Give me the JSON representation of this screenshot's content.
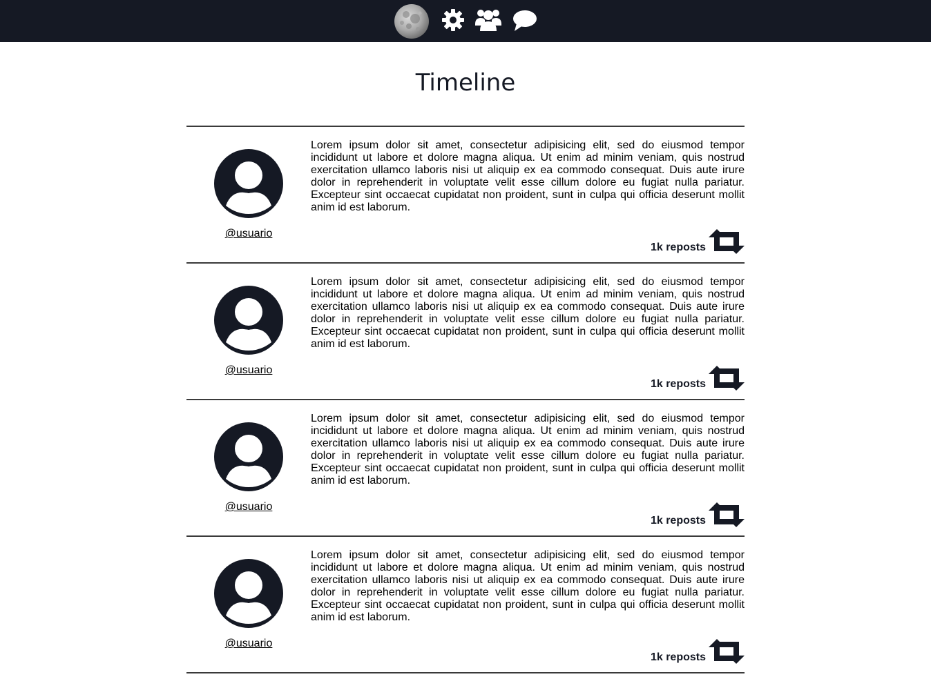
{
  "nav": {
    "icons": [
      "moon-logo-icon",
      "gear-icon",
      "users-icon",
      "chat-bubble-icon"
    ],
    "background_color": "#151924"
  },
  "page": {
    "title": "Timeline"
  },
  "posts": [
    {
      "username": "@usuario",
      "text": "Lorem ipsum dolor sit amet, consectetur adipisicing elit, sed do eiusmod tempor incididunt ut labore et dolore magna aliqua. Ut enim ad minim veniam, quis nostrud exercitation ullamco laboris nisi ut aliquip ex ea commodo consequat. Duis aute irure dolor in reprehenderit in voluptate velit esse cillum dolore eu fugiat nulla pariatur. Excepteur sint occaecat cupidatat non proident, sunt in culpa qui officia deserunt mollit anim id est laborum.",
      "reposts": "1k reposts"
    },
    {
      "username": "@usuario",
      "text": "Lorem ipsum dolor sit amet, consectetur adipisicing elit, sed do eiusmod tempor incididunt ut labore et dolore magna aliqua. Ut enim ad minim veniam, quis nostrud exercitation ullamco laboris nisi ut aliquip ex ea commodo consequat. Duis aute irure dolor in reprehenderit in voluptate velit esse cillum dolore eu fugiat nulla pariatur. Excepteur sint occaecat cupidatat non proident, sunt in culpa qui officia deserunt mollit anim id est laborum.",
      "reposts": "1k reposts"
    },
    {
      "username": "@usuario",
      "text": "Lorem ipsum dolor sit amet, consectetur adipisicing elit, sed do eiusmod tempor incididunt ut labore et dolore magna aliqua. Ut enim ad minim veniam, quis nostrud exercitation ullamco laboris nisi ut aliquip ex ea commodo consequat. Duis aute irure dolor in reprehenderit in voluptate velit esse cillum dolore eu fugiat nulla pariatur. Excepteur sint occaecat cupidatat non proident, sunt in culpa qui officia deserunt mollit anim id est laborum.",
      "reposts": "1k reposts"
    },
    {
      "username": "@usuario",
      "text": "Lorem ipsum dolor sit amet, consectetur adipisicing elit, sed do eiusmod tempor incididunt ut labore et dolore magna aliqua. Ut enim ad minim veniam, quis nostrud exercitation ullamco laboris nisi ut aliquip ex ea commodo consequat. Duis aute irure dolor in reprehenderit in voluptate velit esse cillum dolore eu fugiat nulla pariatur. Excepteur sint occaecat cupidatat non proident, sunt in culpa qui officia deserunt mollit anim id est laborum.",
      "reposts": "1k reposts"
    }
  ]
}
